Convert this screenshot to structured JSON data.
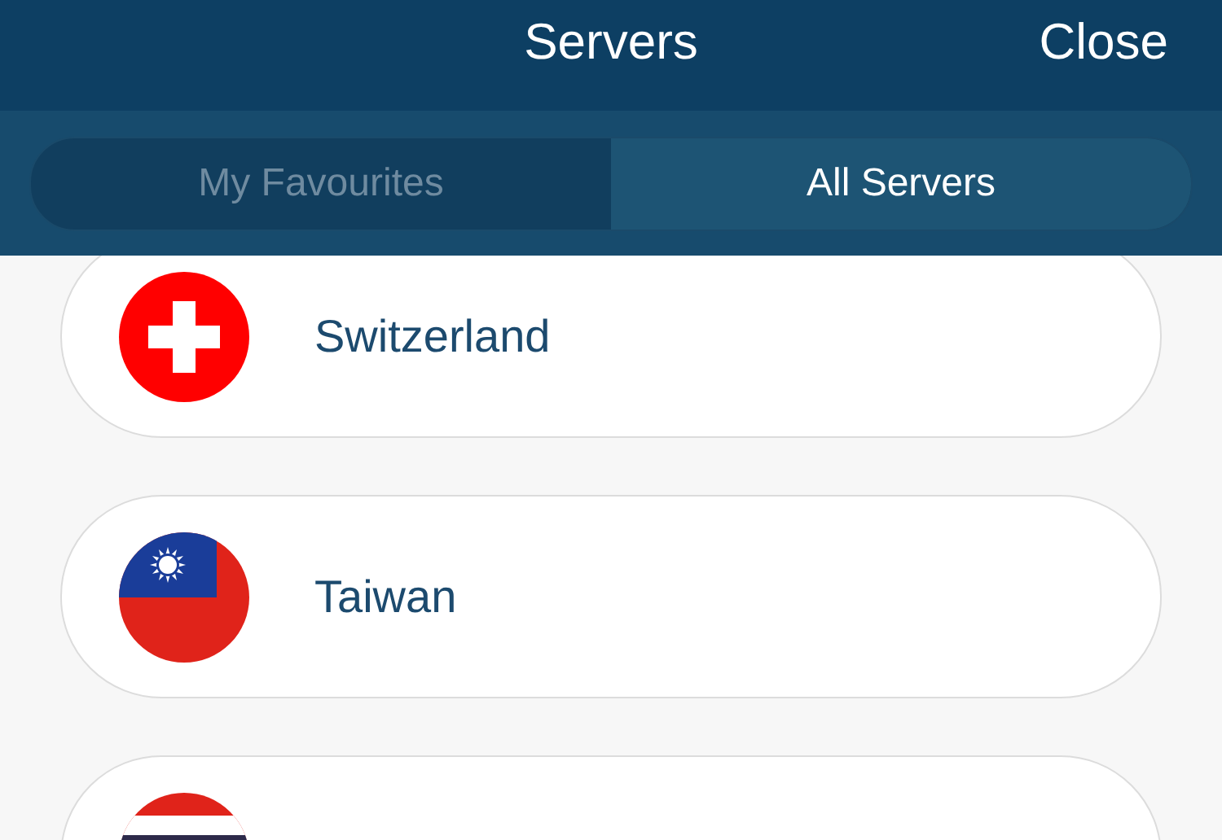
{
  "header": {
    "title": "Servers",
    "close": "Close"
  },
  "tabs": [
    {
      "label": "My Favourites",
      "selected": false
    },
    {
      "label": "All Servers",
      "selected": true
    }
  ],
  "servers": [
    {
      "kind": "cross",
      "name": "Switzerland"
    },
    {
      "kind": "sun",
      "name": "Taiwan"
    },
    {
      "kind": "stripes"
    }
  ]
}
